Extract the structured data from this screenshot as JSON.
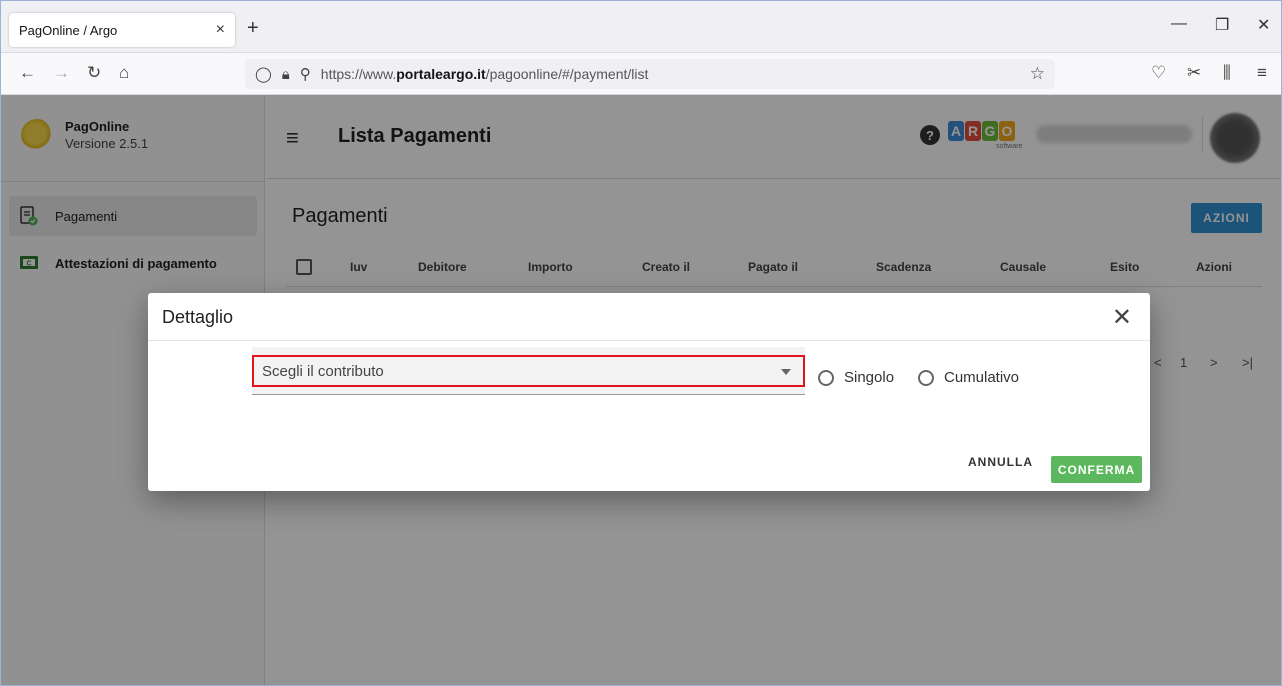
{
  "browser": {
    "tab_title": "PagOnline / Argo",
    "tab_close": "×",
    "new_tab": "+",
    "url_prefix": "https://www.",
    "url_domain": "portaleargo.it",
    "url_path": "/pagoonline/#/payment/list"
  },
  "sidebar": {
    "app_name": "PagOnline",
    "version": "Versione 2.5.1",
    "items": [
      {
        "label": "Pagamenti"
      },
      {
        "label": "Attestazioni di pagamento"
      }
    ]
  },
  "header": {
    "title": "Lista Pagamenti",
    "argo_letters": [
      "A",
      "R",
      "G",
      "O"
    ],
    "argo_colors": [
      "#3c8dd6",
      "#e24c3f",
      "#6fb83d",
      "#f2a81d"
    ],
    "argo_sub": "software"
  },
  "content": {
    "title": "Pagamenti",
    "azioni_label": "AZIONI",
    "columns": [
      "Iuv",
      "Debitore",
      "Importo",
      "Creato il",
      "Pagato il",
      "Scadenza",
      "Causale",
      "Esito",
      "Azioni"
    ],
    "pager": {
      "page": "1"
    }
  },
  "modal": {
    "title": "Dettaglio",
    "select_placeholder": "Scegli il contributo",
    "radio_singolo": "Singolo",
    "radio_cumulativo": "Cumulativo",
    "cancel_label": "ANNULLA",
    "confirm_label": "CONFERMA"
  }
}
